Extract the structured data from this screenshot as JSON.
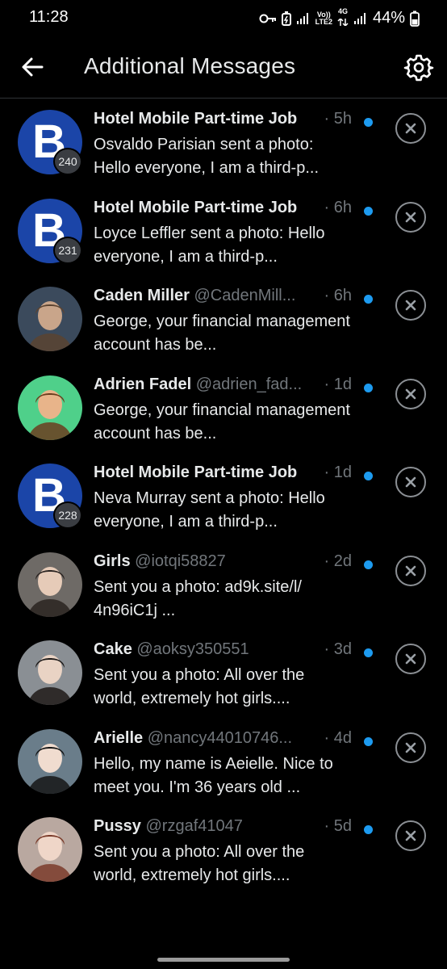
{
  "status_bar": {
    "time": "11:28",
    "network_label_top": "Vo))",
    "network_label_bottom": "LTE2",
    "network_type": "4G",
    "battery_percent": "44%"
  },
  "header": {
    "title": "Additional Messages",
    "back_icon": "arrow-left-icon",
    "settings_icon": "gear-icon"
  },
  "accent_color": "#1d9bf0",
  "messages": [
    {
      "avatar_type": "letter",
      "avatar_letter": "B",
      "badge": "240",
      "name": "Hotel Mobile Part-time Job",
      "handle": "",
      "time": "5h",
      "preview": "Osvaldo Parisian sent a photo: Hello everyone, I am a third-p...",
      "unread": true
    },
    {
      "avatar_type": "letter",
      "avatar_letter": "B",
      "badge": "231",
      "name": "Hotel Mobile Part-time Job",
      "handle": "",
      "time": "6h",
      "preview": "Loyce Leffler sent a photo: Hello everyone, I am a third-p...",
      "unread": true
    },
    {
      "avatar_type": "photo",
      "avatar_letter": "",
      "badge": "",
      "name": "Caden Miller",
      "handle": "@CadenMill...",
      "time": "6h",
      "preview": "George, your financial management account has be...",
      "unread": true
    },
    {
      "avatar_type": "photo",
      "avatar_letter": "",
      "badge": "",
      "name": "Adrien Fadel",
      "handle": "@adrien_fad...",
      "time": "1d",
      "preview": "George, your financial management account has be...",
      "unread": true
    },
    {
      "avatar_type": "letter",
      "avatar_letter": "B",
      "badge": "228",
      "name": "Hotel Mobile Part-time Job",
      "handle": "",
      "time": "1d",
      "preview": "Neva Murray sent a photo: Hello everyone, I am a third-p...",
      "unread": true
    },
    {
      "avatar_type": "photo",
      "avatar_letter": "",
      "badge": "",
      "name": "Girls",
      "handle": "@iotqi58827",
      "time": "2d",
      "preview": "Sent you a photo: ad9k.site/l/ 4n96iC1j ...",
      "unread": true
    },
    {
      "avatar_type": "photo",
      "avatar_letter": "",
      "badge": "",
      "name": "Cake",
      "handle": "@aoksy350551",
      "time": "3d",
      "preview": "Sent you a photo: All over the world, extremely hot girls....",
      "unread": true
    },
    {
      "avatar_type": "photo",
      "avatar_letter": "",
      "badge": "",
      "name": "Arielle",
      "handle": "@nancy44010746...",
      "time": "4d",
      "preview": "Hello, my name is Aeielle. Nice to meet you. I'm 36 years old ...",
      "unread": true
    },
    {
      "avatar_type": "photo",
      "avatar_letter": "",
      "badge": "",
      "name": "Pussy",
      "handle": "@rzgaf41047",
      "time": "5d",
      "preview": "Sent you a photo: All over the world, extremely hot girls....",
      "unread": true
    }
  ]
}
